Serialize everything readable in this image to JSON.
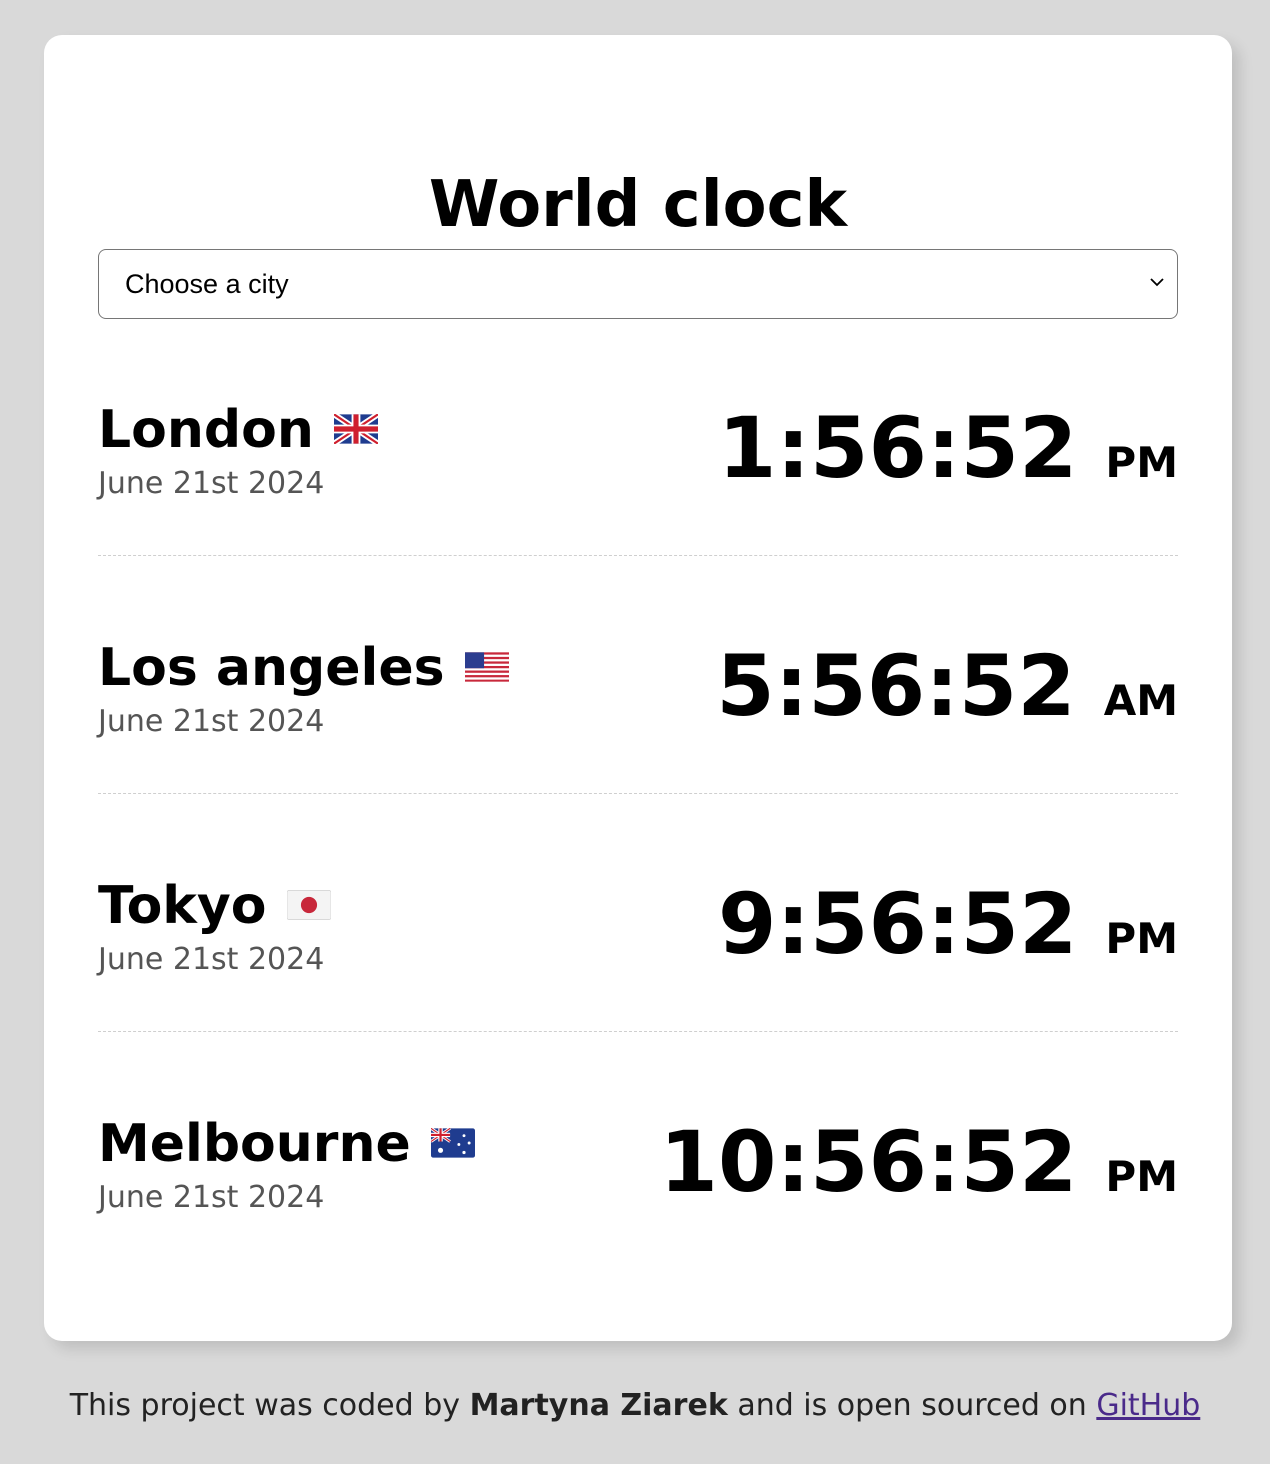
{
  "header": {
    "title": "World clock"
  },
  "city_select": {
    "selected_label": "Choose a city"
  },
  "cities": [
    {
      "name": "London",
      "flag_icon": "uk-flag-icon",
      "date": "June 21st 2024",
      "time": "1:56:52",
      "period": "PM"
    },
    {
      "name": "Los angeles",
      "flag_icon": "us-flag-icon",
      "date": "June 21st 2024",
      "time": "5:56:52",
      "period": "AM"
    },
    {
      "name": "Tokyo",
      "flag_icon": "japan-flag-icon",
      "date": "June 21st 2024",
      "time": "9:56:52",
      "period": "PM"
    },
    {
      "name": "Melbourne",
      "flag_icon": "australia-flag-icon",
      "date": "June 21st 2024",
      "time": "10:56:52",
      "period": "PM"
    }
  ],
  "footer": {
    "prefix": "This project was coded by",
    "author": "Martyna Ziarek",
    "middle": "and is open sourced on",
    "link_label": "GitHub"
  },
  "colors": {
    "page_background": "#d9d9d9",
    "card_background": "#ffffff",
    "date_text": "#555555",
    "link": "#4a2a8a"
  }
}
